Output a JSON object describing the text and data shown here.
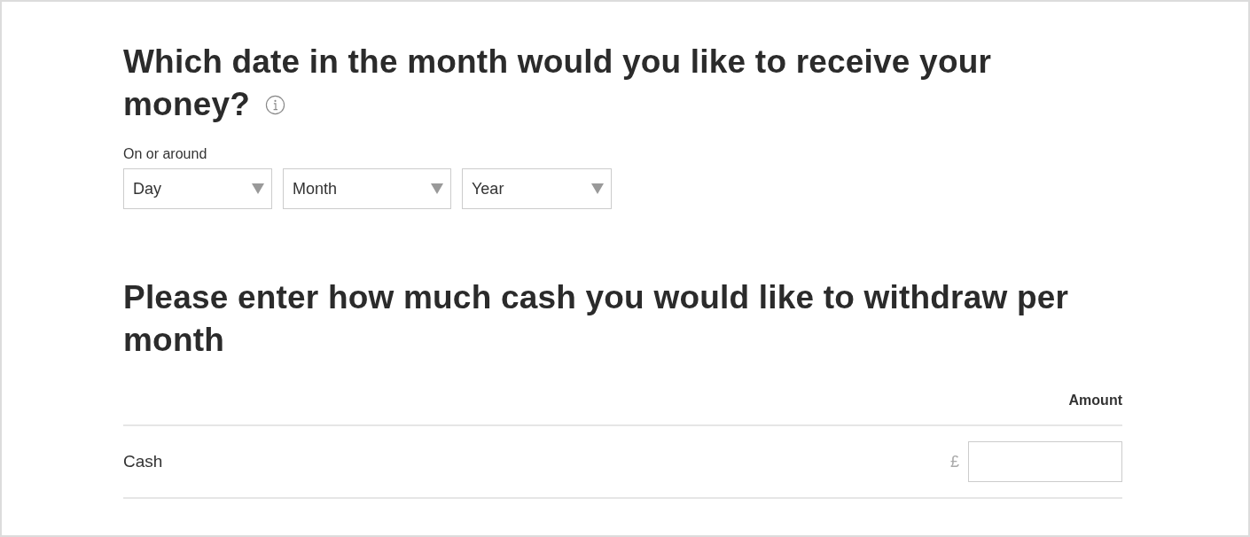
{
  "date_section": {
    "heading": "Which date in the month would you like to receive your money?",
    "label": "On or around",
    "selects": [
      {
        "value": "Day"
      },
      {
        "value": "Month"
      },
      {
        "value": "Year"
      }
    ]
  },
  "cash_section": {
    "heading": "Please enter how much cash you would like to withdraw per month",
    "column_header": "Amount",
    "rows": [
      {
        "label": "Cash",
        "currency": "£"
      }
    ]
  }
}
